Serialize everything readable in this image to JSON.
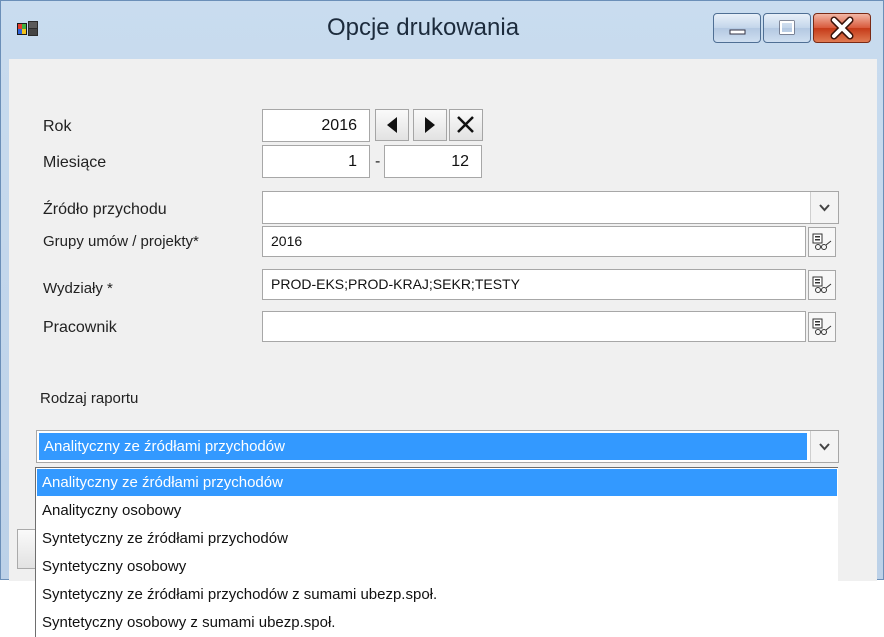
{
  "window": {
    "title": "Opcje drukowania"
  },
  "form": {
    "rok": {
      "label": "Rok",
      "value": "2016"
    },
    "miesiace": {
      "label": "Miesiące",
      "from": "1",
      "sep": "-",
      "to": "12"
    },
    "zrodlo": {
      "label": "Źródło przychodu",
      "value": ""
    },
    "grupy": {
      "label": "Grupy umów  / projekty*",
      "value": "2016"
    },
    "wydzialy": {
      "label": "Wydziały *",
      "value": "PROD-EKS;PROD-KRAJ;SEKR;TESTY"
    },
    "pracownik": {
      "label": "Pracownik",
      "value": ""
    }
  },
  "report": {
    "label": "Rodzaj raportu",
    "selected": "Analityczny ze źródłami przychodów",
    "options": [
      "Analityczny ze źródłami przychodów",
      "Analityczny osobowy",
      "Syntetyczny ze źródłami przychodów",
      "Syntetyczny osobowy",
      "Syntetyczny ze źródłami przychodów z sumami ubezp.społ.",
      "Syntetyczny osobowy z sumami ubezp.społ."
    ]
  },
  "icons": {
    "app": "app-icon",
    "prev": "triangle-left-icon",
    "next": "triangle-right-icon",
    "clear": "x-icon",
    "picker": "picker-icon",
    "combo": "chevron-down-icon"
  },
  "colors": {
    "selection": "#3399ff",
    "close": "#c53a18"
  }
}
